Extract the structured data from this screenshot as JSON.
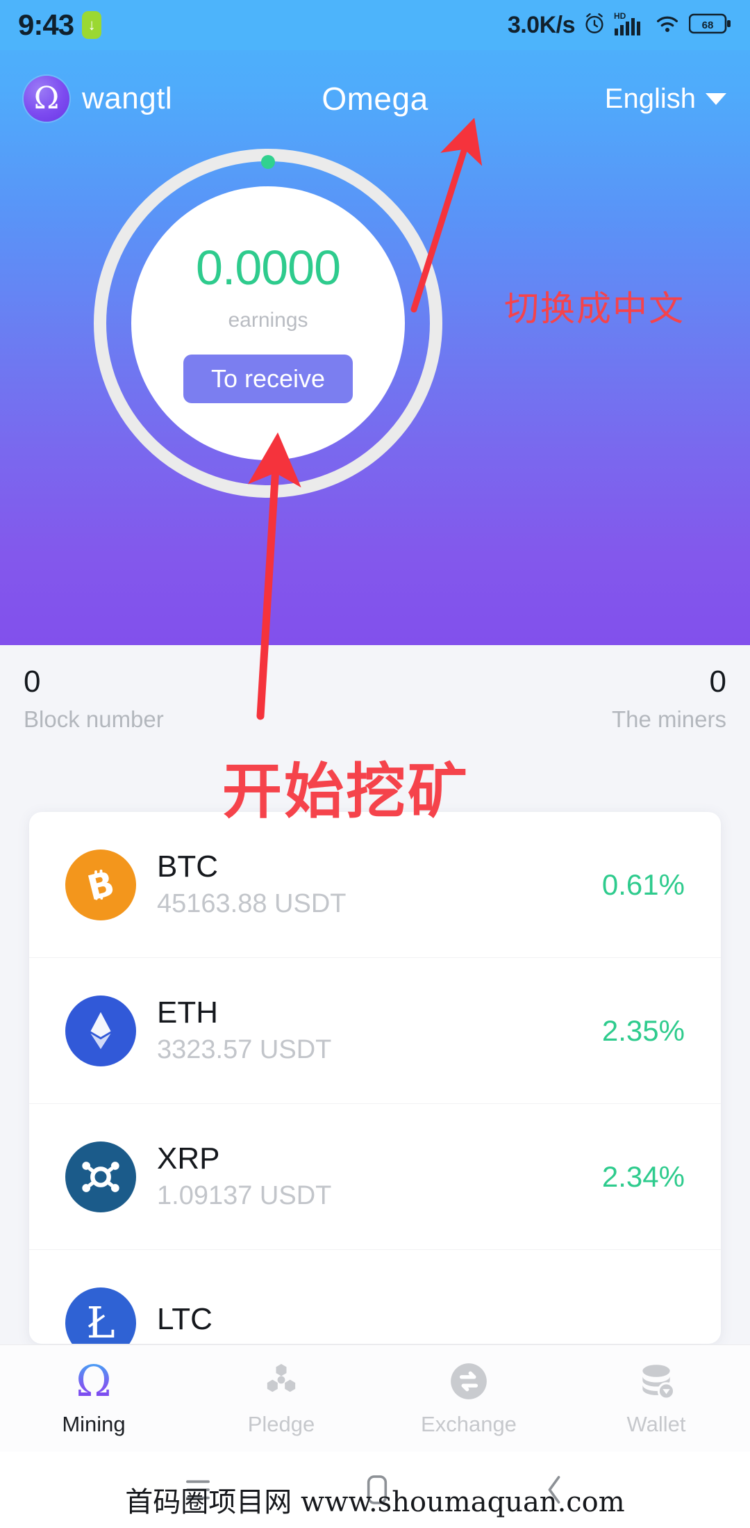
{
  "statusbar": {
    "time": "9:43",
    "download_icon": "download-arrow-icon",
    "network_speed": "3.0K/s",
    "alarm_icon": "alarm-clock-icon",
    "hd_label": "HD",
    "signal_icon": "cellular-signal-icon",
    "wifi_icon": "wifi-icon",
    "battery_level": "68"
  },
  "appbar": {
    "logo_glyph": "Ω",
    "logo_icon": "omega-logo-icon",
    "username": "wangtl",
    "title": "Omega",
    "language": "English",
    "caret_icon": "chevron-down-icon"
  },
  "dial": {
    "earnings_value": "0.0000",
    "earnings_label": "earnings",
    "receive_button": "To receive",
    "progress_dot_color": "#31d18f",
    "ring_color": "#ebebeb",
    "value_color": "#2ecb8d",
    "button_color": "#7b7ef0"
  },
  "stats": {
    "block_number_value": "0",
    "block_number_label": "Block number",
    "miners_value": "0",
    "miners_label": "The miners"
  },
  "coins": [
    {
      "symbol": "BTC",
      "price": "45163.88 USDT",
      "change": "0.61%",
      "icon": "bitcoin-icon",
      "color": "#f3961c"
    },
    {
      "symbol": "ETH",
      "price": "3323.57 USDT",
      "change": "2.35%",
      "icon": "ethereum-icon",
      "color": "#3159d8"
    },
    {
      "symbol": "XRP",
      "price": "1.09137 USDT",
      "change": "2.34%",
      "icon": "ripple-icon",
      "color": "#1b5b8a"
    },
    {
      "symbol": "LTC",
      "price": "",
      "change": "",
      "icon": "litecoin-icon",
      "color": "#2f62d4"
    }
  ],
  "tabbar": [
    {
      "label": "Mining",
      "icon": "omega-icon",
      "active": true
    },
    {
      "label": "Pledge",
      "icon": "molecule-icon",
      "active": false
    },
    {
      "label": "Exchange",
      "icon": "swap-circle-icon",
      "active": false
    },
    {
      "label": "Wallet",
      "icon": "coins-stack-icon",
      "active": false
    }
  ],
  "sysnav": {
    "menu_icon": "hamburger-menu-icon",
    "home_icon": "home-square-icon",
    "back_icon": "back-chevron-icon"
  },
  "annotations": {
    "switch_to_chinese": "切换成中文",
    "start_mining": "开始挖矿",
    "arrow_to_language": "red-arrow-to-language-icon",
    "arrow_to_receive": "red-arrow-to-receive-icon",
    "color": "#f5434b"
  },
  "watermark": "首码圈项目网 www.shoumaquan.com"
}
